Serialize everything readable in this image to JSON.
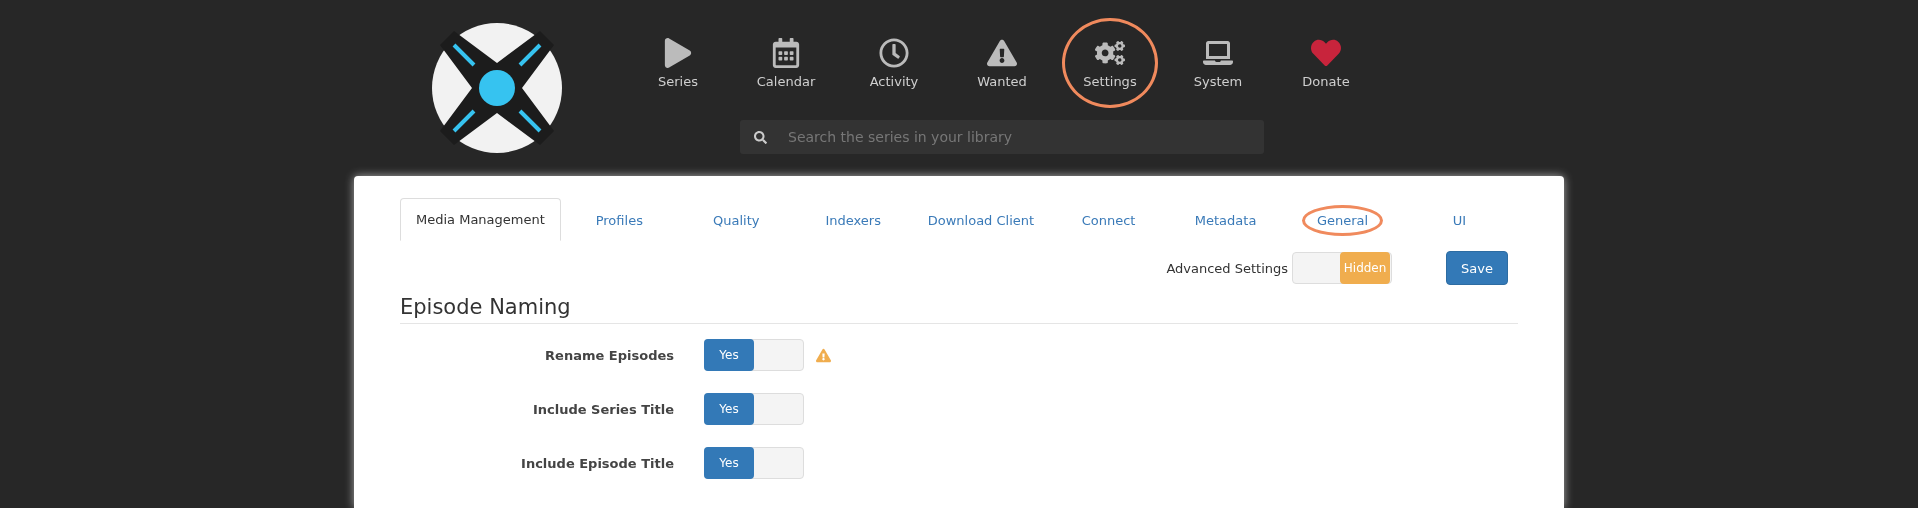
{
  "nav": [
    {
      "label": "Series",
      "color": "#bbbbbb",
      "highlighted": false
    },
    {
      "label": "Calendar",
      "color": "#bbbbbb",
      "highlighted": false
    },
    {
      "label": "Activity",
      "color": "#bbbbbb",
      "highlighted": false
    },
    {
      "label": "Wanted",
      "color": "#bbbbbb",
      "highlighted": false
    },
    {
      "label": "Settings",
      "color": "#bbbbbb",
      "highlighted": true
    },
    {
      "label": "System",
      "color": "#bbbbbb",
      "highlighted": false
    },
    {
      "label": "Donate",
      "color": "#c8243c",
      "highlighted": false
    }
  ],
  "search": {
    "placeholder": "Search the series in your library"
  },
  "tabs": [
    {
      "label": "Media Management",
      "selected": true,
      "highlighted": false
    },
    {
      "label": "Profiles",
      "selected": false,
      "highlighted": false
    },
    {
      "label": "Quality",
      "selected": false,
      "highlighted": false
    },
    {
      "label": "Indexers",
      "selected": false,
      "highlighted": false
    },
    {
      "label": "Download Client",
      "selected": false,
      "highlighted": false
    },
    {
      "label": "Connect",
      "selected": false,
      "highlighted": false
    },
    {
      "label": "Metadata",
      "selected": false,
      "highlighted": false
    },
    {
      "label": "General",
      "selected": false,
      "highlighted": true
    },
    {
      "label": "UI",
      "selected": false,
      "highlighted": false
    }
  ],
  "advanced": {
    "label": "Advanced Settings",
    "value": "Hidden",
    "on": false
  },
  "save_button": "Save",
  "section_title": "Episode Naming",
  "fields": [
    {
      "label": "Rename Episodes",
      "value": "Yes",
      "on": true,
      "warning": true
    },
    {
      "label": "Include Series Title",
      "value": "Yes",
      "on": true,
      "warning": false
    },
    {
      "label": "Include Episode Title",
      "value": "Yes",
      "on": true,
      "warning": false
    }
  ]
}
